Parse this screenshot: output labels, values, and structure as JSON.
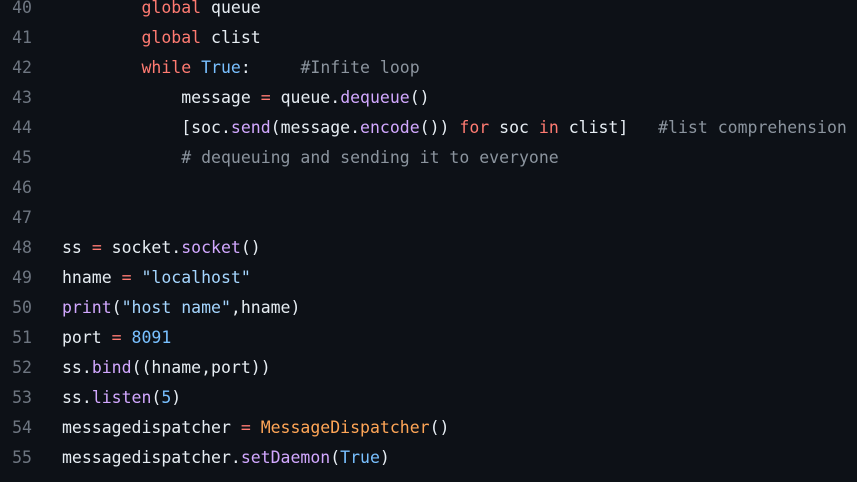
{
  "editor": {
    "lines": [
      {
        "n": "40",
        "indent": "        ",
        "tokens": [
          {
            "t": "global",
            "c": "kw"
          },
          {
            "t": " queue",
            "c": ""
          }
        ]
      },
      {
        "n": "41",
        "indent": "        ",
        "tokens": [
          {
            "t": "global",
            "c": "kw"
          },
          {
            "t": " clist",
            "c": ""
          }
        ]
      },
      {
        "n": "42",
        "indent": "        ",
        "tokens": [
          {
            "t": "while",
            "c": "kw"
          },
          {
            "t": " ",
            "c": ""
          },
          {
            "t": "True",
            "c": "bl"
          },
          {
            "t": ":     ",
            "c": ""
          },
          {
            "t": "#Infite loop",
            "c": "cm"
          }
        ]
      },
      {
        "n": "43",
        "indent": "            ",
        "tokens": [
          {
            "t": "message ",
            "c": ""
          },
          {
            "t": "=",
            "c": "kw"
          },
          {
            "t": " queue.",
            "c": ""
          },
          {
            "t": "dequeue",
            "c": "fn"
          },
          {
            "t": "()",
            "c": ""
          }
        ]
      },
      {
        "n": "44",
        "indent": "            ",
        "tokens": [
          {
            "t": "[soc.",
            "c": ""
          },
          {
            "t": "send",
            "c": "fn"
          },
          {
            "t": "(message.",
            "c": ""
          },
          {
            "t": "encode",
            "c": "fn"
          },
          {
            "t": "()) ",
            "c": ""
          },
          {
            "t": "for",
            "c": "kw"
          },
          {
            "t": " soc ",
            "c": ""
          },
          {
            "t": "in",
            "c": "kw"
          },
          {
            "t": " clist]   ",
            "c": ""
          },
          {
            "t": "#list comprehension",
            "c": "cm"
          }
        ]
      },
      {
        "n": "45",
        "indent": "            ",
        "tokens": [
          {
            "t": "# dequeuing and sending it to everyone",
            "c": "cm"
          }
        ]
      },
      {
        "n": "46",
        "indent": "",
        "tokens": []
      },
      {
        "n": "47",
        "indent": "",
        "tokens": []
      },
      {
        "n": "48",
        "indent": "",
        "tokens": [
          {
            "t": "ss ",
            "c": ""
          },
          {
            "t": "=",
            "c": "kw"
          },
          {
            "t": " socket.",
            "c": ""
          },
          {
            "t": "socket",
            "c": "fn"
          },
          {
            "t": "()",
            "c": ""
          }
        ]
      },
      {
        "n": "49",
        "indent": "",
        "tokens": [
          {
            "t": "hname ",
            "c": ""
          },
          {
            "t": "=",
            "c": "kw"
          },
          {
            "t": " ",
            "c": ""
          },
          {
            "t": "\"localhost\"",
            "c": "st"
          }
        ]
      },
      {
        "n": "50",
        "indent": "",
        "tokens": [
          {
            "t": "print",
            "c": "fn"
          },
          {
            "t": "(",
            "c": ""
          },
          {
            "t": "\"host name\"",
            "c": "st"
          },
          {
            "t": ",hname)",
            "c": ""
          }
        ]
      },
      {
        "n": "51",
        "indent": "",
        "tokens": [
          {
            "t": "port ",
            "c": ""
          },
          {
            "t": "=",
            "c": "kw"
          },
          {
            "t": " ",
            "c": ""
          },
          {
            "t": "8091",
            "c": "bl"
          }
        ]
      },
      {
        "n": "52",
        "indent": "",
        "tokens": [
          {
            "t": "ss.",
            "c": ""
          },
          {
            "t": "bind",
            "c": "fn"
          },
          {
            "t": "((hname,port))",
            "c": ""
          }
        ]
      },
      {
        "n": "53",
        "indent": "",
        "tokens": [
          {
            "t": "ss.",
            "c": ""
          },
          {
            "t": "listen",
            "c": "fn"
          },
          {
            "t": "(",
            "c": ""
          },
          {
            "t": "5",
            "c": "bl"
          },
          {
            "t": ")",
            "c": ""
          }
        ]
      },
      {
        "n": "54",
        "indent": "",
        "tokens": [
          {
            "t": "messagedispatcher ",
            "c": ""
          },
          {
            "t": "=",
            "c": "kw"
          },
          {
            "t": " ",
            "c": ""
          },
          {
            "t": "MessageDispatcher",
            "c": "cl"
          },
          {
            "t": "()",
            "c": ""
          }
        ]
      },
      {
        "n": "55",
        "indent": "",
        "tokens": [
          {
            "t": "messagedispatcher.",
            "c": ""
          },
          {
            "t": "setDaemon",
            "c": "fn"
          },
          {
            "t": "(",
            "c": ""
          },
          {
            "t": "True",
            "c": "bl"
          },
          {
            "t": ")",
            "c": ""
          }
        ]
      }
    ]
  }
}
